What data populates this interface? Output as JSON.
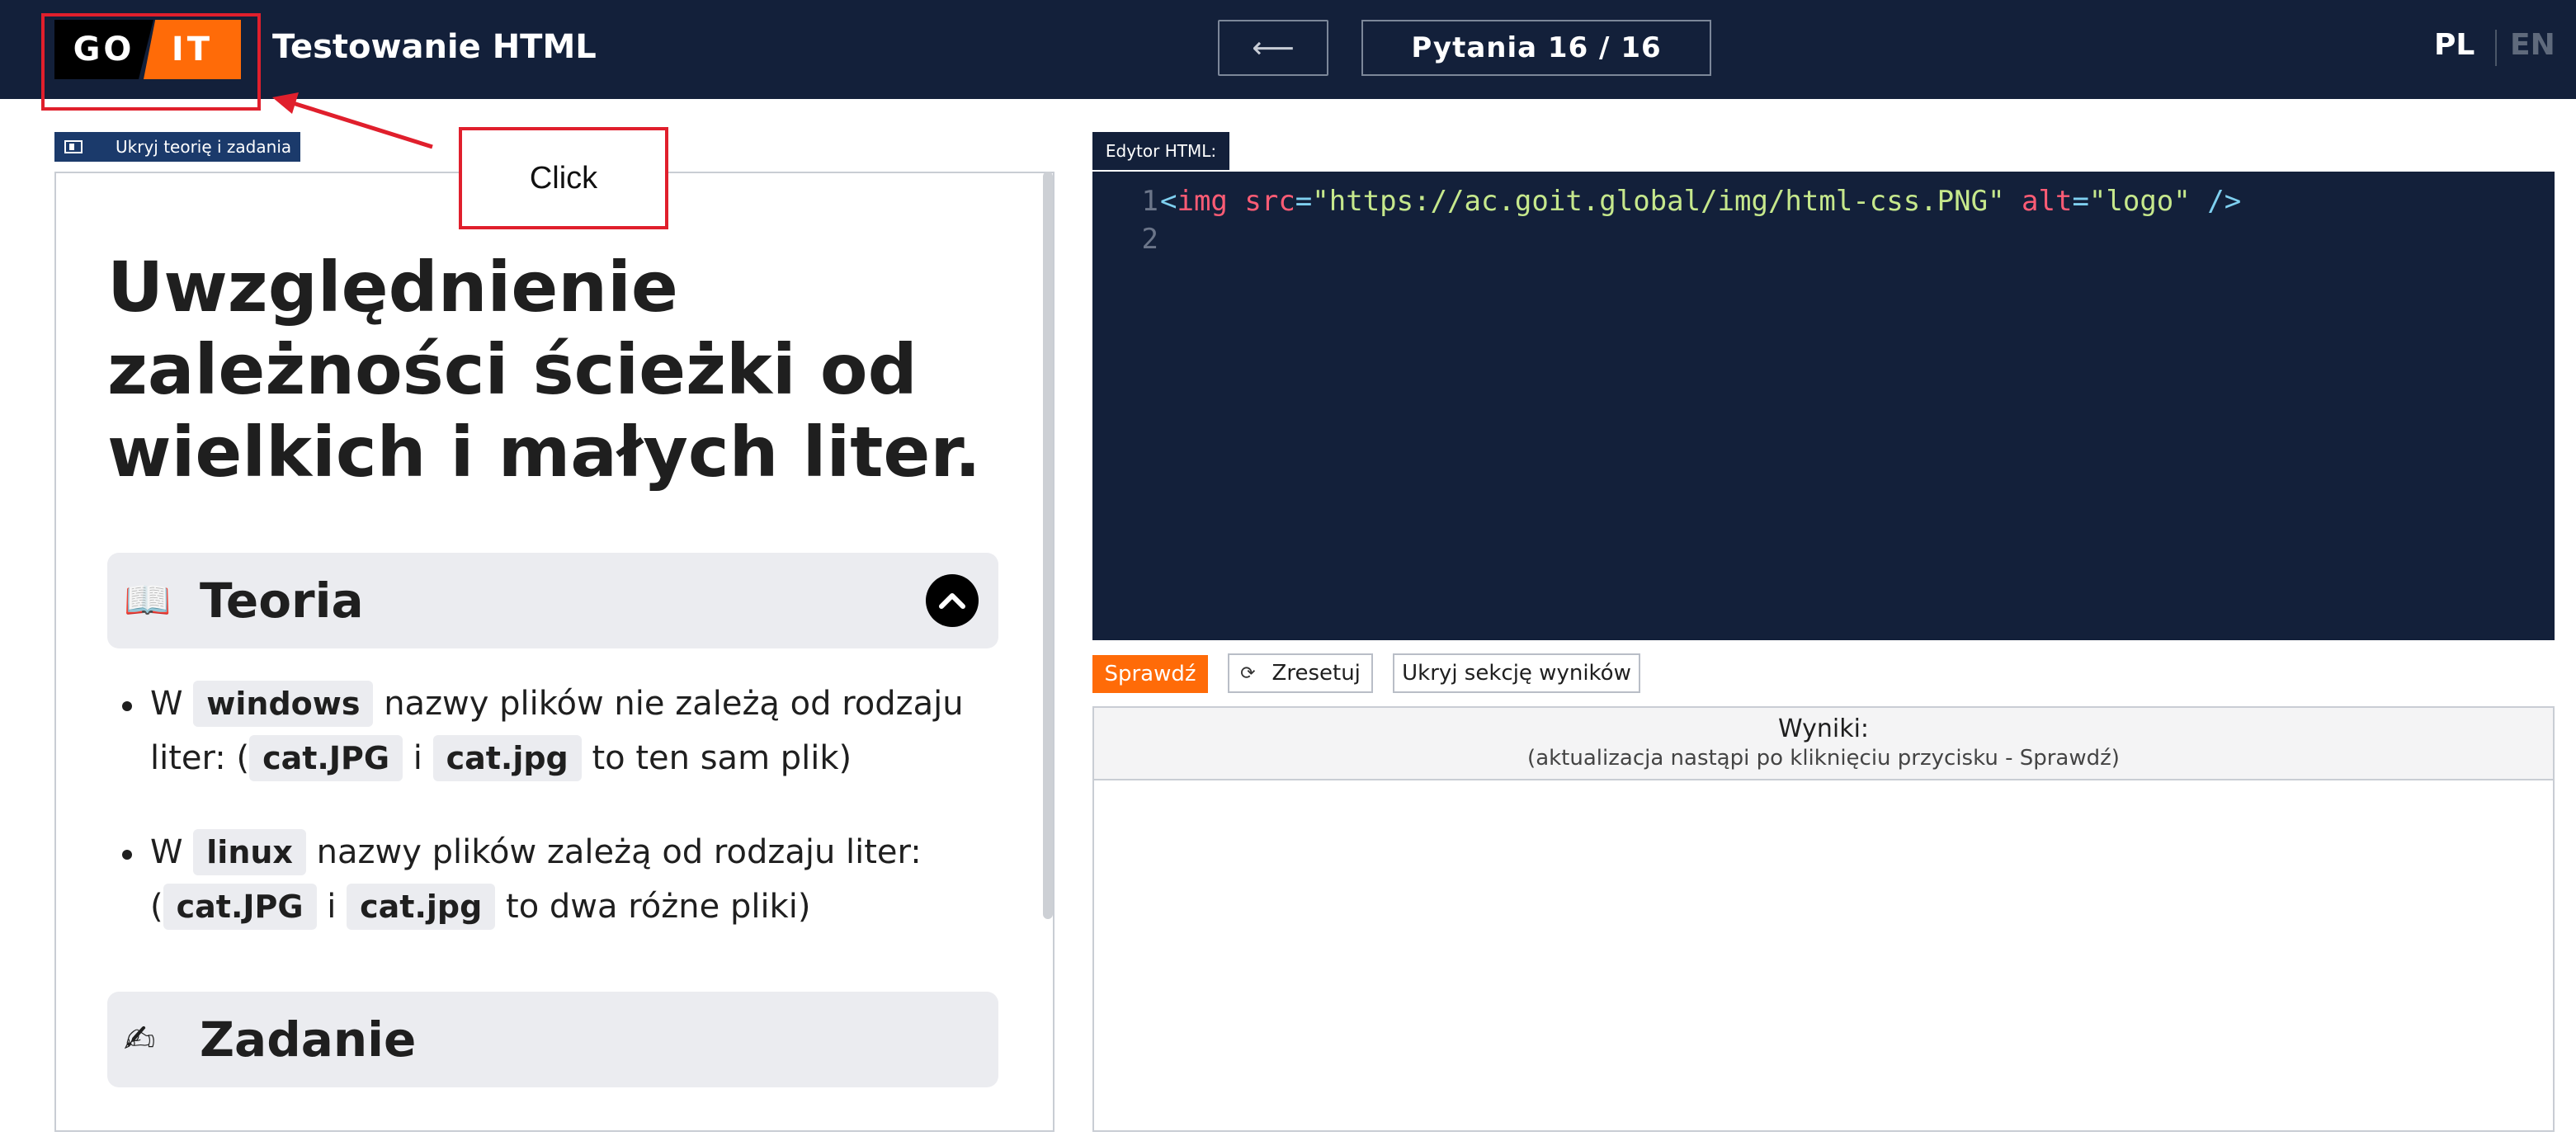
{
  "header": {
    "logo_left": "GO",
    "logo_right": "IT",
    "title": "Testowanie HTML",
    "back_arrow": "⟵",
    "question_counter": "Pytania 16 / 16",
    "lang_active": "PL",
    "lang_inactive": "EN"
  },
  "annotation": {
    "click_label": "Click",
    "color": "#e01f2c"
  },
  "theory_panel": {
    "toggle_label": "Ukryj teorię i zadania",
    "lesson_title_lines": [
      "Uwzględnienie",
      "zależności ścieżki od",
      "wielkich i małych liter."
    ],
    "theory_section": {
      "icon": "📖",
      "title": "Teoria"
    },
    "theory_items": [
      {
        "line1": {
          "pre": "W ",
          "chip": "windows",
          "post": " nazwy plików nie zależą od rodzaju"
        },
        "line2": {
          "pre": "liter: (",
          "chip1": "cat.JPG",
          "mid": " i ",
          "chip2": "cat.jpg",
          "post": " to ten sam plik)"
        }
      },
      {
        "line1": {
          "pre": "W ",
          "chip": "linux",
          "post": " nazwy plików zależą od rodzaju liter:"
        },
        "line2": {
          "pre": "(",
          "chip1": "cat.JPG",
          "mid": " i ",
          "chip2": "cat.jpg",
          "post": " to dwa różne pliki)"
        }
      }
    ],
    "task_section": {
      "icon": "✍",
      "title": "Zadanie"
    }
  },
  "editor": {
    "tab_label": "Edytor HTML:",
    "lines": [
      {
        "number": "1",
        "tokens": [
          {
            "t": "<",
            "c": "tok-punct"
          },
          {
            "t": "img",
            "c": "tok-tag"
          },
          {
            "t": " src",
            "c": "tok-attr"
          },
          {
            "t": "=",
            "c": "tok-eq"
          },
          {
            "t": "\"https://ac.goit.global/img/html-css.PNG\"",
            "c": "tok-str"
          },
          {
            "t": " alt",
            "c": "tok-attr"
          },
          {
            "t": "=",
            "c": "tok-eq"
          },
          {
            "t": "\"logo\"",
            "c": "tok-str"
          },
          {
            "t": " />",
            "c": "tok-punct"
          }
        ]
      },
      {
        "number": "2",
        "tokens": []
      }
    ]
  },
  "actions": {
    "check_label": "Sprawdź",
    "reset_label": "Zresetuj",
    "hide_results_label": "Ukryj sekcję wyników"
  },
  "results": {
    "title": "Wyniki:",
    "subtitle": "(aktualizacja nastąpi po kliknięciu przycisku - Sprawdź)"
  },
  "colors": {
    "header_bg": "#13203a",
    "accent_orange": "#ff6b08",
    "section_bg": "#ebecf0"
  }
}
